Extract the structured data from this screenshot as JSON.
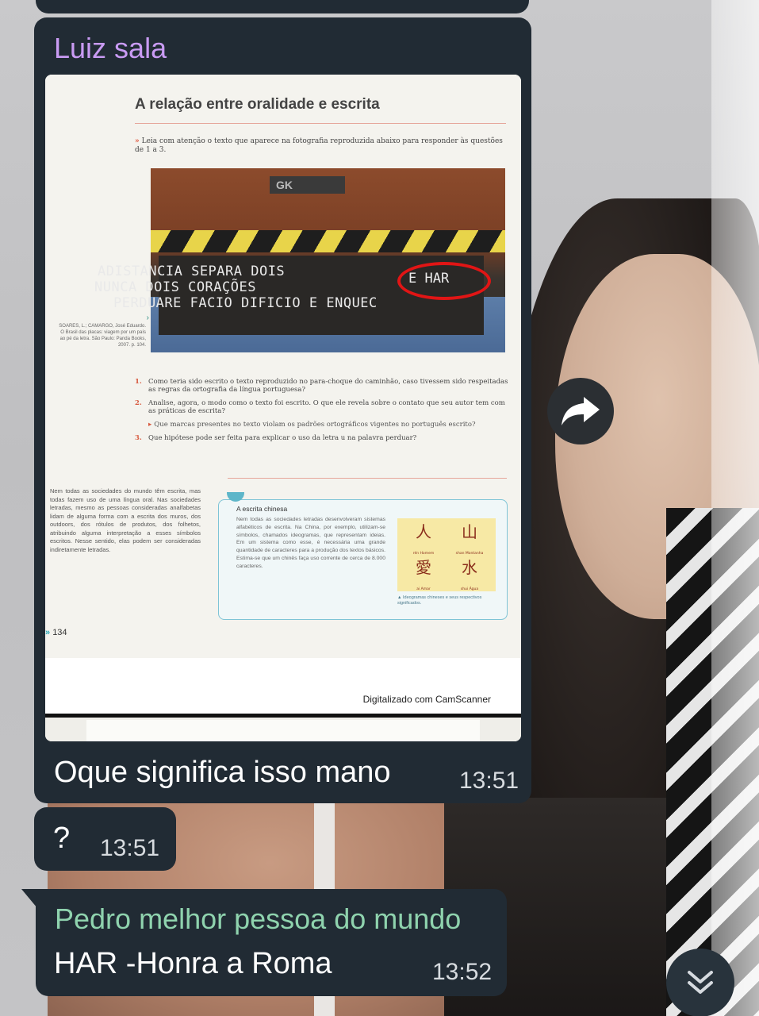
{
  "messages": {
    "main": {
      "sender": "Luiz sala",
      "text": "Oque significa isso mano",
      "time": "13:51"
    },
    "question": {
      "text": "?",
      "time": "13:51"
    },
    "reply": {
      "sender": "Pedro melhor pessoa do mundo",
      "text": "HAR -Honra a Roma",
      "time": "13:52"
    }
  },
  "photo": {
    "title": "A relação entre oralidade e escrita",
    "instruction": "Leia com atenção o texto que aparece na fotografia reproduzida abaixo para responder às questões de 1 a 3.",
    "truck_plate": "GK",
    "bumper_text": [
      "ADISTANCIA SEPARA DOIS",
      "NUNCA DOIS CORAÇÕES",
      "PERDUARE FACIO DIFICIO E ENQUEC"
    ],
    "circled_text": "E HAR",
    "caption": "SOARES, L.; CAMARGO, José Eduardo. O Brasil das placas: viagem por um país ao pé da letra. São Paulo: Panda Books, 2007. p. 104.",
    "questions": [
      {
        "num": "1.",
        "text": "Como teria sido escrito o texto reproduzido no para-choque do caminhão, caso tivessem sido respeitadas as regras da ortografia da língua portuguesa?"
      },
      {
        "num": "2.",
        "text": "Analise, agora, o modo como o texto foi escrito. O que ele revela sobre o contato que seu autor tem com as práticas de escrita?"
      },
      {
        "num": "3.",
        "text": "Que hipótese pode ser feita para explicar o uso da letra u na palavra perduar?"
      }
    ],
    "sub_question": "Que marcas presentes no texto violam os padrões ortográficos vigentes no português escrito?",
    "left_paragraph": "Nem todas as sociedades do mundo têm escrita, mas todas fazem uso de uma língua oral. Nas sociedades letradas, mesmo as pessoas consideradas analfabetas lidam de alguma forma com a escrita dos muros, dos outdoors, dos rótulos de produtos, dos folhetos, atribuindo alguma interpretação a esses símbolos escritos. Nesse sentido, elas podem ser consideradas indiretamente letradas.",
    "box": {
      "title": "A escrita chinesa",
      "text": "Nem todas as sociedades letradas desenvolveram sistemas alfabéticos de escrita. Na China, por exemplo, utilizam-se símbolos, chamados ideogramas, que representam ideias. Em um sistema como esse, é necessária uma grande quantidade de caracteres para a produção dos textos básicos. Estima-se que um chinês faça uso corrente de cerca de 8.000 caracteres.",
      "ideograms": [
        {
          "char": "人",
          "label": "rén Homem"
        },
        {
          "char": "山",
          "label": "shan Montanha"
        },
        {
          "char": "愛",
          "label": "ai Amar"
        },
        {
          "char": "水",
          "label": "shui Água"
        }
      ],
      "ideogram_caption": "Ideogramas chineses e seus respectivos significados."
    },
    "page_number": "134",
    "scanner_label": "Digitalizado com CamScanner"
  },
  "icons": {
    "forward": "share-forward-icon",
    "scroll_down": "double-chevron-down-icon"
  },
  "colors": {
    "bubble": "#212b34",
    "sender_luiz": "#c99bf3",
    "sender_pedro": "#8fd3ae",
    "circle": "#e11515"
  }
}
